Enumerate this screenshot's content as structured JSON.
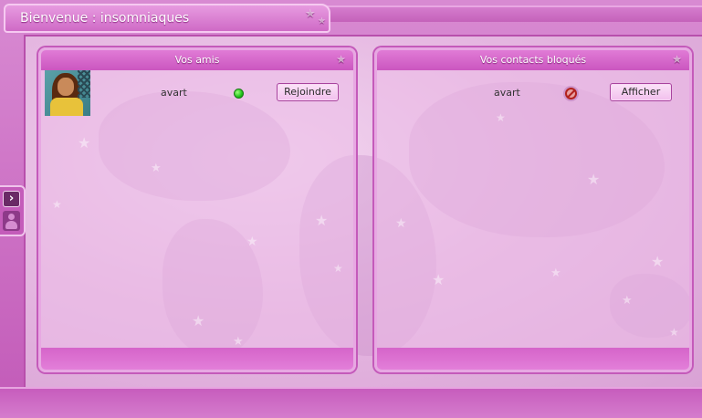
{
  "window": {
    "title": "Bienvenue : insomniaques"
  },
  "friends_panel": {
    "title": "Vos amis",
    "items": [
      {
        "name": "avart",
        "status": "online",
        "action_label": "Rejoindre"
      }
    ]
  },
  "blocked_panel": {
    "title": "Vos contacts bloqués",
    "items": [
      {
        "name": "avart",
        "status": "blocked",
        "action_label": "Afficher"
      }
    ]
  },
  "side_tab": {
    "expand_icon": "chevron-right-icon",
    "contacts_icon": "person-icon"
  },
  "colors": {
    "accent": "#cb56c0",
    "online": "#1fc21a",
    "blocked": "#b2211e"
  }
}
